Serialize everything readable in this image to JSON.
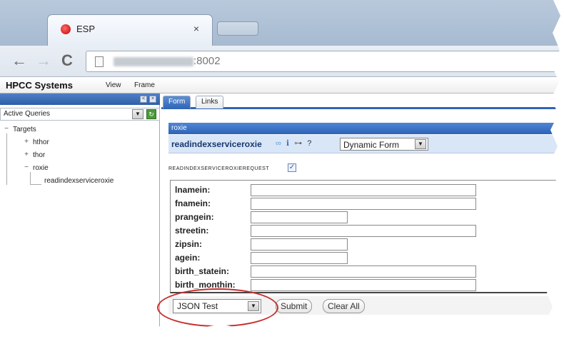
{
  "browser": {
    "tab_title": "ESP",
    "tab_close": "×",
    "url_suffix": ":8002"
  },
  "app": {
    "brand": "HPCC Systems",
    "menu": {
      "view": "View",
      "frame": "Frame"
    }
  },
  "left_panel": {
    "selector": "Active Queries",
    "tree": {
      "root": "Targets",
      "items": [
        "hthor",
        "thor",
        "roxie"
      ],
      "leaf": "readindexserviceroxie"
    }
  },
  "right_panel": {
    "tabs": {
      "form": "Form",
      "links": "Links"
    },
    "cluster": "roxie",
    "service_name": "readindexserviceroxie",
    "form_mode": "Dynamic Form",
    "request_label": "readindexserviceroxieRequest",
    "fields": [
      "lnamein:",
      "fnamein:",
      "prangein:",
      "streetin:",
      "zipsin:",
      "agein:",
      "birth_statein:",
      "birth_monthin:"
    ],
    "test_mode": "JSON Test",
    "buttons": {
      "submit": "Submit",
      "clear": "Clear All"
    }
  },
  "colors": {
    "accent": "#2f66b8",
    "highlight_ring": "#c82d2d"
  }
}
